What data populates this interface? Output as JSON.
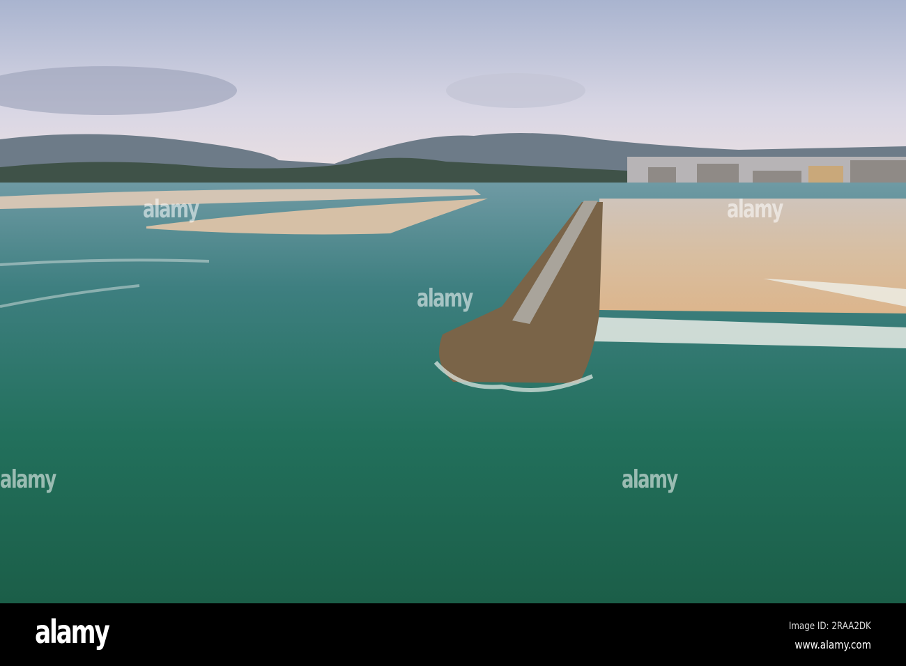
{
  "watermark": {
    "text": "alamy"
  },
  "footer": {
    "brand": "alamy",
    "image_id": "Image ID: 2RAA2DK",
    "website": "www.alamy.com"
  },
  "colors": {
    "sky_top": "#aab3cc",
    "sky_bottom": "#e8dfe6",
    "sea_deep": "#1e6a52",
    "sea_light": "#4a8a88",
    "sand": "#d9b894"
  }
}
